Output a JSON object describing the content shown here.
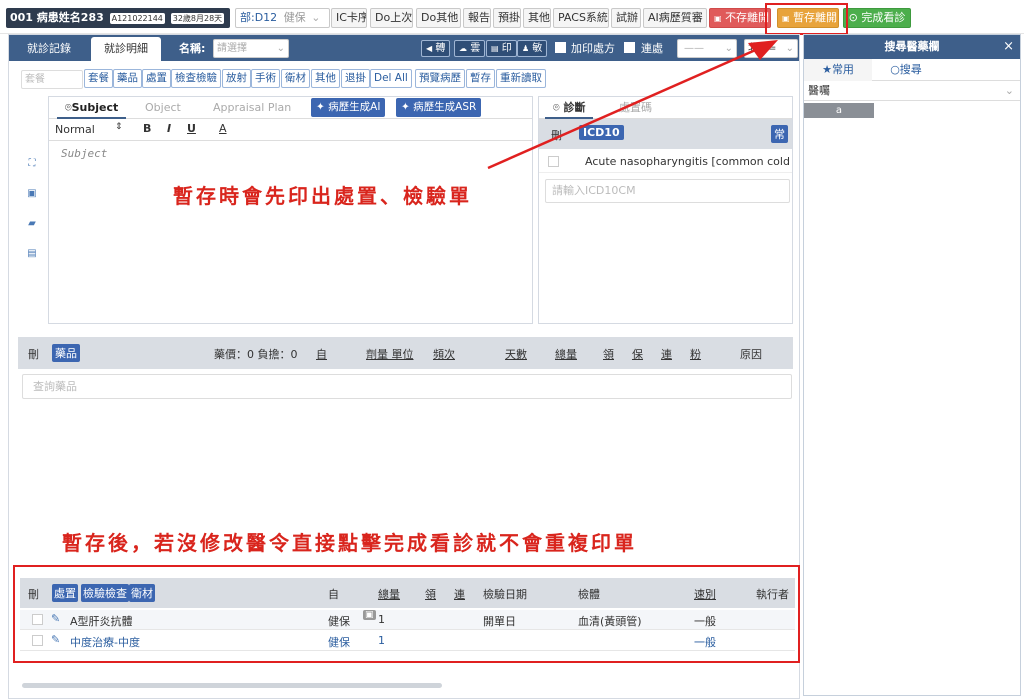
{
  "topbar": {
    "patient_name": "001 病患姓名283",
    "id_tag": "A121022144",
    "age_tag": "32歲8月28天",
    "add_symbol": "+",
    "dept": "部:D12",
    "insurance": "健保",
    "buttons": [
      "IC卡序",
      "Do上次",
      "Do其他",
      "報告",
      "預掛",
      "其他",
      "PACS系統",
      "試辦",
      "AI病歷質審"
    ],
    "nosave": "不存離開",
    "tempsave": "暫存離開",
    "complete": "完成看診"
  },
  "tabs": {
    "record": "就診記錄",
    "detail": "就診明細",
    "name_label": "名稱:",
    "name_placeholder": "請選擇"
  },
  "header_buttons": [
    "轉",
    "雲",
    "印",
    "敏"
  ],
  "checkboxes": {
    "add_print": "加印處方",
    "consult": "連處"
  },
  "right_select": "北韶=",
  "order_search_placeholder": "套餐",
  "order_buttons": [
    "套餐",
    "藥品",
    "處置",
    "檢查檢驗",
    "放射",
    "手術",
    "衛材",
    "其他",
    "退掛",
    "Del All",
    "預覽病歷",
    "暫存",
    "重新讀取"
  ],
  "editor": {
    "tabs": [
      "Subject",
      "Object",
      "Appraisal Plan"
    ],
    "ai_buttons": [
      "病歷生成AI",
      "病歷生成ASR"
    ],
    "format": "Normal",
    "bold": "B",
    "italic": "I",
    "underline": "U",
    "color": "A",
    "placeholder": "Subject"
  },
  "diagnosis": {
    "tab_active": "診斷",
    "tab_other": "處置碼",
    "delete_label": "刪",
    "code_label": "ICD10",
    "common_label": "常",
    "item": "Acute nasopharyngitis [common cold...",
    "input_placeholder": "請輸入ICD10CM"
  },
  "drug_table": {
    "delete_label": "刪",
    "tag": "藥品",
    "price_info": "藥價：0 負擔：0",
    "columns": [
      "自",
      "劑量 單位",
      "頻次",
      "天數",
      "總量",
      "領",
      "保",
      "連",
      "粉",
      "原因"
    ],
    "search_placeholder": "查詢藥品"
  },
  "annotations": {
    "top": "暫存時會先印出處置、檢驗單",
    "bottom": "暫存後，若沒修改醫令直接點擊完成看診就不會重複印單"
  },
  "order_table": {
    "delete_label": "刪",
    "tags": [
      "處置",
      "檢驗檢查",
      "衛材"
    ],
    "columns": [
      "自",
      "總量",
      "領",
      "連",
      "檢驗日期",
      "檢體",
      "速別",
      "執行者"
    ],
    "rows": [
      {
        "name": "A型肝炎抗體",
        "self": "健保",
        "total": "1",
        "date": "開單日",
        "specimen": "血清(黃頭管)",
        "speed": "一般"
      },
      {
        "name": "中度治療-中度",
        "self": "健保",
        "total": "1",
        "date": "",
        "specimen": "",
        "speed": "一般"
      }
    ]
  },
  "side_panel": {
    "title": "搜尋醫藥欄",
    "close": "×",
    "tab_common": "常用",
    "tab_search": "搜尋",
    "select_value": "醫囑",
    "item": "a"
  },
  "colors": {
    "header_blue": "#3e5f8a",
    "annotation_red": "#d9251d",
    "highlight_red": "#e02020"
  }
}
